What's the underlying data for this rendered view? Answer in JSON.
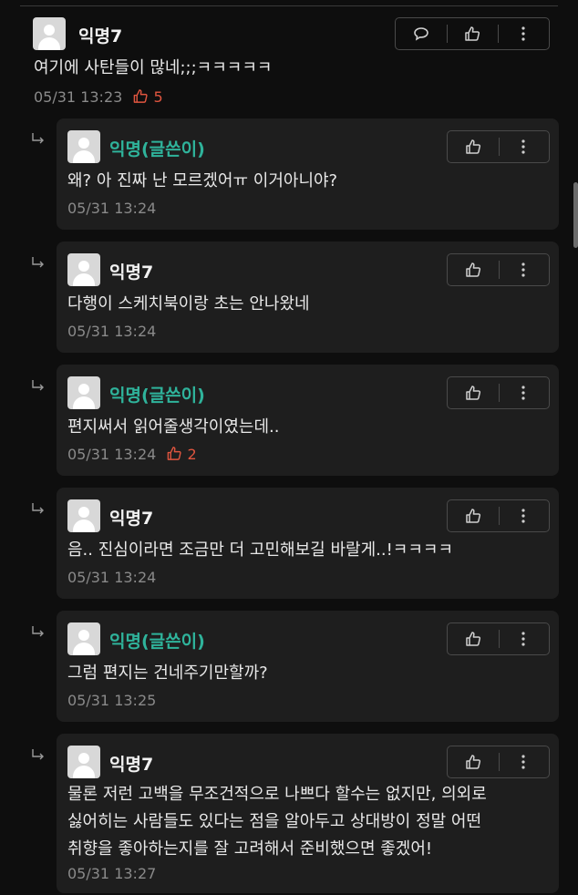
{
  "comments": [
    {
      "author": "익명7",
      "author_is_op": false,
      "text": "여기에 사탄들이 많네;;;ㅋㅋㅋㅋㅋ",
      "time": "05/31 13:23",
      "likes": "5",
      "is_reply": false
    },
    {
      "author": "익명(글쓴이)",
      "author_is_op": true,
      "text": "왜? 아 진짜 난 모르겠어ㅠ 이거아니야?",
      "time": "05/31 13:24",
      "is_reply": true
    },
    {
      "author": "익명7",
      "author_is_op": false,
      "text": "다행이 스케치북이랑 초는 안나왔네",
      "time": "05/31 13:24",
      "is_reply": true
    },
    {
      "author": "익명(글쓴이)",
      "author_is_op": true,
      "text": "편지써서 읽어줄생각이였는데..",
      "time": "05/31 13:24",
      "likes": "2",
      "is_reply": true
    },
    {
      "author": "익명7",
      "author_is_op": false,
      "text": "음.. 진심이라면 조금만 더 고민해보길 바랄게..!ㅋㅋㅋㅋ",
      "time": "05/31 13:24",
      "is_reply": true
    },
    {
      "author": "익명(글쓴이)",
      "author_is_op": true,
      "text": "그럼 편지는 건네주기만할까?",
      "time": "05/31 13:25",
      "is_reply": true
    },
    {
      "author": "익명7",
      "author_is_op": false,
      "text_lines": [
        "물론 저런 고백을 무조건적으로 나쁘다 할수는 없지만, 의외로",
        "싫어히는 사람들도 있다는 점을 알아두고 상대방이 정말 어떤",
        "취향을 좋아하는지를 잘 고려해서 준비했으면 좋겠어!"
      ],
      "time": "05/31 13:27",
      "is_reply": true
    }
  ],
  "icons": {
    "comment": "speech-bubble-icon",
    "like": "thumbs-up-icon",
    "more": "vertical-dots-icon",
    "reply": "reply-arrow-icon"
  },
  "colors": {
    "background": "#0e0e0e",
    "card": "#1e1e1e",
    "op_author": "#2fb39b",
    "like_accent": "#e0553f"
  }
}
